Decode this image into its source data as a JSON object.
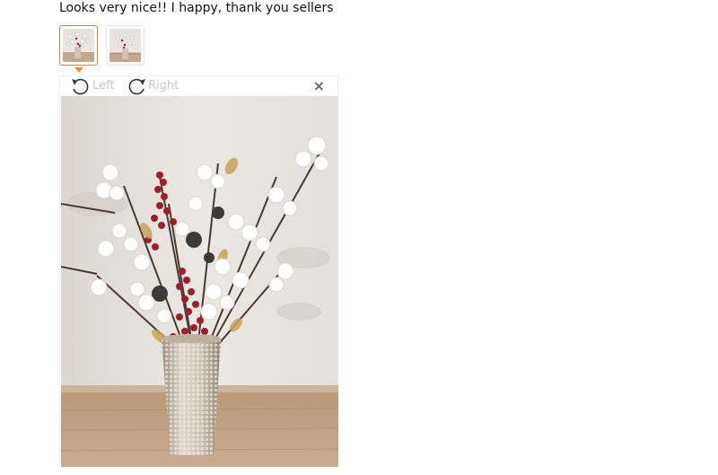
{
  "review": {
    "text": "Looks very nice!! I happy, thank you sellers"
  },
  "thumbnails": [
    {
      "label": "",
      "icon": "photo-thumbnail",
      "active": true
    },
    {
      "label": "",
      "icon": "photo-thumbnail",
      "active": false
    }
  ],
  "viewer": {
    "rotate_left_label": "Left",
    "rotate_right_label": "Right",
    "close_label": "×",
    "icons": [
      "rotate-left-icon",
      "rotate-right-icon",
      "close-icon"
    ]
  },
  "colors": {
    "accent": "#f58b3b",
    "muted_text": "#c8c8c8",
    "wall": "#e9e6e2",
    "floor": "#c19f82",
    "berry": "#a01e2c"
  }
}
